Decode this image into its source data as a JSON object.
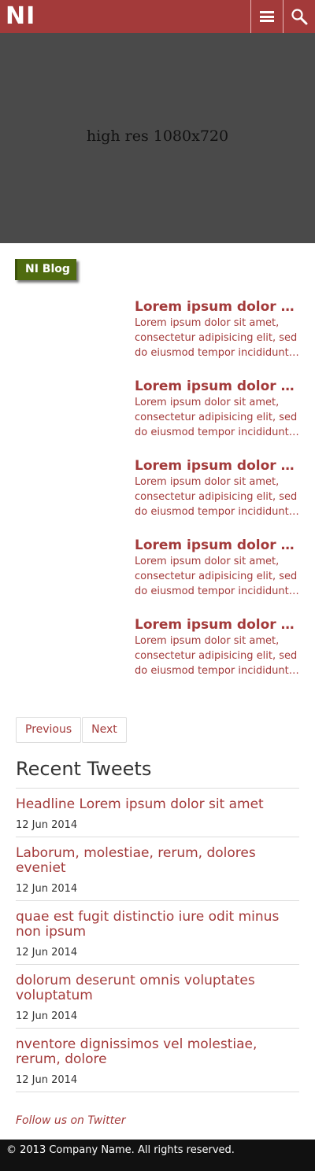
{
  "header": {
    "logo": "NI",
    "menu_icon": "hamburger-menu-icon",
    "search_icon": "magnifier-search-icon",
    "brand_color": "#a33a3a"
  },
  "hero": {
    "text": "high res 1080x720"
  },
  "blog_tag": "NI Blog",
  "posts": [
    {
      "title": "Lorem ipsum dolor sit amet",
      "excerpt_lines": [
        "Lorem ipsum dolor sit amet,",
        "consectetur adipisicing elit, sed",
        "do eiusmod tempor incididunt ut labore"
      ]
    },
    {
      "title": "Lorem ipsum dolor sit amet",
      "excerpt_lines": [
        "Lorem ipsum dolor sit amet,",
        "consectetur adipisicing elit, sed",
        "do eiusmod tempor incididunt ut labore"
      ]
    },
    {
      "title": "Lorem ipsum dolor sit amet",
      "excerpt_lines": [
        "Lorem ipsum dolor sit amet,",
        "consectetur adipisicing elit, sed",
        "do eiusmod tempor incididunt ut labore"
      ]
    },
    {
      "title": "Lorem ipsum dolor sit amet",
      "excerpt_lines": [
        "Lorem ipsum dolor sit amet,",
        "consectetur adipisicing elit, sed",
        "do eiusmod tempor incididunt ut labore"
      ]
    },
    {
      "title": "Lorem ipsum dolor sit amet",
      "excerpt_lines": [
        "Lorem ipsum dolor sit amet,",
        "consectetur adipisicing elit, sed",
        "do eiusmod tempor incididunt ut labore"
      ]
    }
  ],
  "pager": {
    "previous": "Previous",
    "next": "Next"
  },
  "tweets": {
    "heading": "Recent Tweets",
    "items": [
      {
        "text": "Headline Lorem ipsum dolor sit amet",
        "date": "12 Jun 2014"
      },
      {
        "text": "Laborum, molestiae, rerum, dolores eveniet",
        "date": "12 Jun 2014"
      },
      {
        "text": "quae est fugit distinctio iure odit minus non ipsum",
        "date": "12 Jun 2014"
      },
      {
        "text": "dolorum deserunt omnis voluptates voluptatum",
        "date": "12 Jun 2014"
      },
      {
        "text": "nventore dignissimos vel molestiae, rerum, dolore",
        "date": "12 Jun 2014"
      }
    ],
    "follow": "Follow us on Twitter"
  },
  "footer": {
    "copyright": "© 2013 Company Name. All rights reserved."
  }
}
